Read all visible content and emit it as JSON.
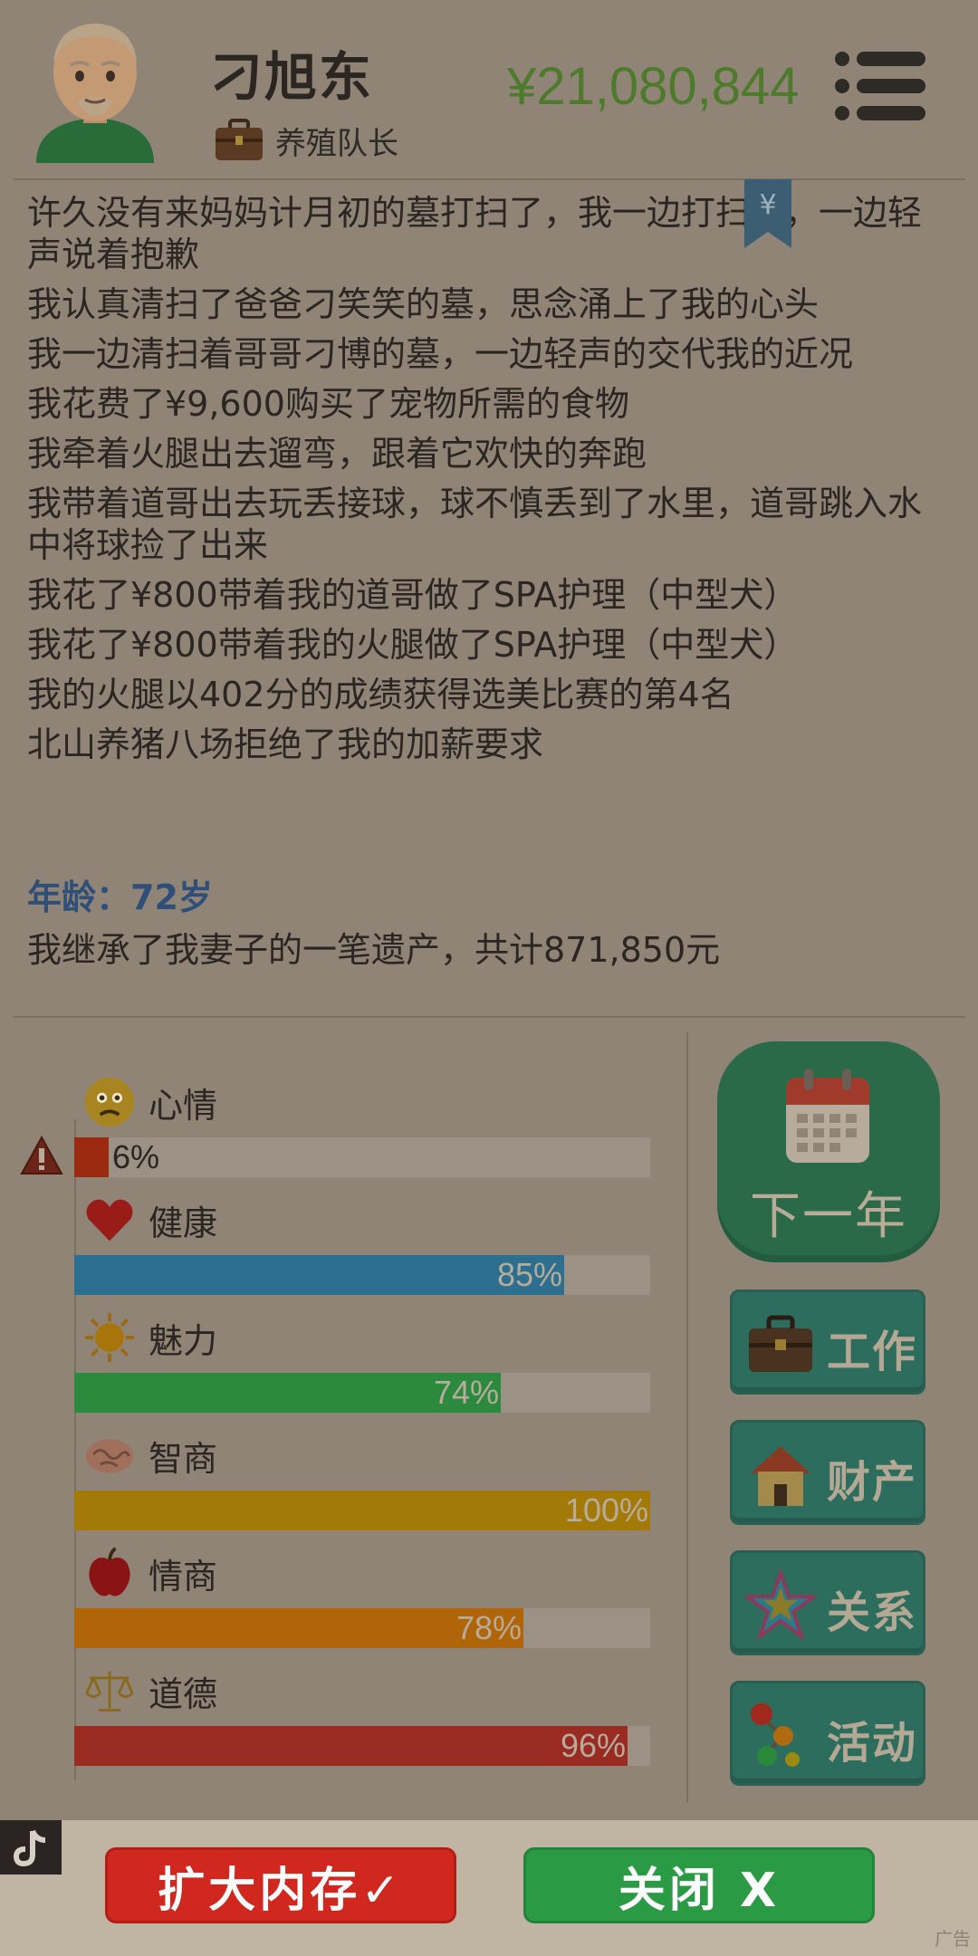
{
  "header": {
    "name": "刁旭东",
    "job": "养殖队长",
    "money": "¥21,080,844",
    "bookmark_symbol": "¥"
  },
  "log": [
    "许久没有来妈妈计月初的墓打扫了，我一边打扫着，一边轻声说着抱歉",
    "我认真清扫了爸爸刁笑笑的墓，思念涌上了我的心头",
    "我一边清扫着哥哥刁博的墓，一边轻声的交代我的近况",
    "我花费了¥9,600购买了宠物所需的食物",
    "我牵着火腿出去遛弯，跟着它欢快的奔跑",
    "我带着道哥出去玩丢接球，球不慎丢到了水里，道哥跳入水中将球捡了出来",
    "我花了¥800带着我的道哥做了SPA护理（中型犬）",
    "我花了¥800带着我的火腿做了SPA护理（中型犬）",
    "我的火腿以402分的成绩获得选美比赛的第4名",
    "北山养猪八场拒绝了我的加薪要求"
  ],
  "age_line": "年龄：72岁",
  "inherit_line": "我继承了我妻子的一笔遗产，共计871,850元",
  "stats": [
    {
      "key": "mood",
      "label": "心情",
      "value": 6,
      "text": "6%",
      "color": "#9a2a10",
      "icon": "worried-face-icon"
    },
    {
      "key": "health",
      "label": "健康",
      "value": 85,
      "text": "85%",
      "color": "#2c6f8f",
      "icon": "heart-icon"
    },
    {
      "key": "charm",
      "label": "魅力",
      "value": 74,
      "text": "74%",
      "color": "#2c8a3f",
      "icon": "sun-icon"
    },
    {
      "key": "iq",
      "label": "智商",
      "value": 100,
      "text": "100%",
      "color": "#a37a07",
      "icon": "brain-icon"
    },
    {
      "key": "eq",
      "label": "情商",
      "value": 78,
      "text": "78%",
      "color": "#b06508",
      "icon": "apple-icon"
    },
    {
      "key": "morality",
      "label": "道德",
      "value": 96,
      "text": "96%",
      "color": "#9a2b22",
      "icon": "scales-icon"
    }
  ],
  "buttons": {
    "next_year": "下一年",
    "work": "工作",
    "property": "财产",
    "relations": "关系",
    "activities": "活动"
  },
  "ad": {
    "left_button": "扩大内存✓",
    "right_button": "关闭 X",
    "tag": "广告"
  }
}
